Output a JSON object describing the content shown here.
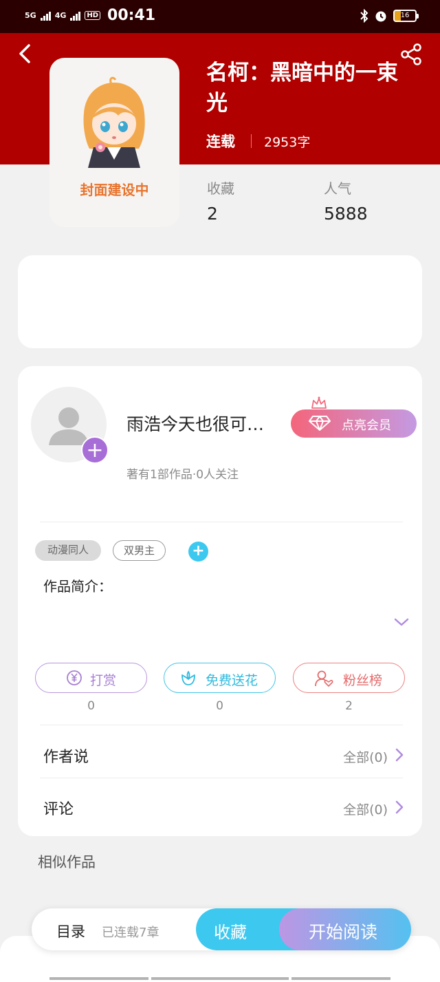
{
  "status_bar": {
    "network1": "5G",
    "network2": "4G",
    "hd": "HD",
    "time": "00:41",
    "battery": "16"
  },
  "book": {
    "title": "名柯：黑暗中的一束光",
    "status": "连载",
    "word_count": "2953字",
    "cover_text": "封面建设中",
    "stats": [
      {
        "label": "收藏",
        "value": "2"
      },
      {
        "label": "人气",
        "value": "5888"
      }
    ]
  },
  "author": {
    "name": "雨浩今天也很可…",
    "meta": "著有1部作品·0人关注",
    "vip_button": "点亮会员"
  },
  "tags": [
    "动漫同人",
    "双男主"
  ],
  "intro_label": "作品简介：",
  "actions": [
    {
      "label": "打赏",
      "count": "0",
      "icon": "yen-icon"
    },
    {
      "label": "免费送花",
      "count": "0",
      "icon": "flower-icon"
    },
    {
      "label": "粉丝榜",
      "count": "2",
      "icon": "fan-user-icon"
    }
  ],
  "sections": [
    {
      "title": "作者说",
      "link": "全部(0)"
    },
    {
      "title": "评论",
      "link": "全部(0)"
    }
  ],
  "similar_label": "相似作品",
  "bottom_bar": {
    "toc": "目录",
    "toc_sub": "已连载7章",
    "favorite": "收藏",
    "read": "开始阅读"
  },
  "colors": {
    "header_red": "#b10000",
    "purple": "#a77fd3",
    "cyan": "#3dc8ef",
    "coral": "#e46b6b"
  }
}
